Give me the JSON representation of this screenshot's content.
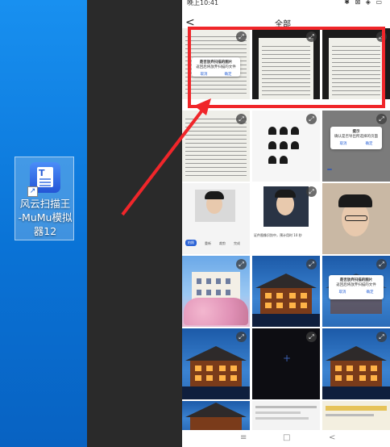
{
  "desktop": {
    "icon_label_lines": [
      "风云扫描王",
      "-MuMu模拟",
      "器12"
    ],
    "shortcut_glyph": "↗",
    "app_icon_glyph": "T"
  },
  "phone": {
    "status": {
      "time": "晚上10:41",
      "icons": "✱ ⊠ ◈ ▭"
    },
    "topbar": {
      "back": "<",
      "title": "全部"
    },
    "cells": [
      {
        "dialog_title": "是否放弃扫描的图片",
        "dialog_body": "返回后将放弃扫描的文件",
        "cancel": "取消",
        "confirm": "确定"
      },
      {
        "dialog_title": "提示",
        "dialog_body": "确认是否导出所选择的页面",
        "cancel": "取消",
        "confirm": "确定"
      },
      {
        "status_text": "证件图像识别中，预计用时 10 秒",
        "buttons": [
          "拍照",
          "重新",
          "裁剪",
          "完成"
        ]
      },
      {
        "dialog_title": "是否放弃扫描的图片",
        "dialog_body": "返回后将放弃扫描的文件",
        "cancel": "取消",
        "confirm": "确定"
      }
    ]
  },
  "navbar": {
    "menu": "≡",
    "home": "□",
    "back": "<"
  },
  "colors": {
    "highlight": "#f0262a",
    "arrow": "#f0262a",
    "accent": "#2b63d6"
  }
}
